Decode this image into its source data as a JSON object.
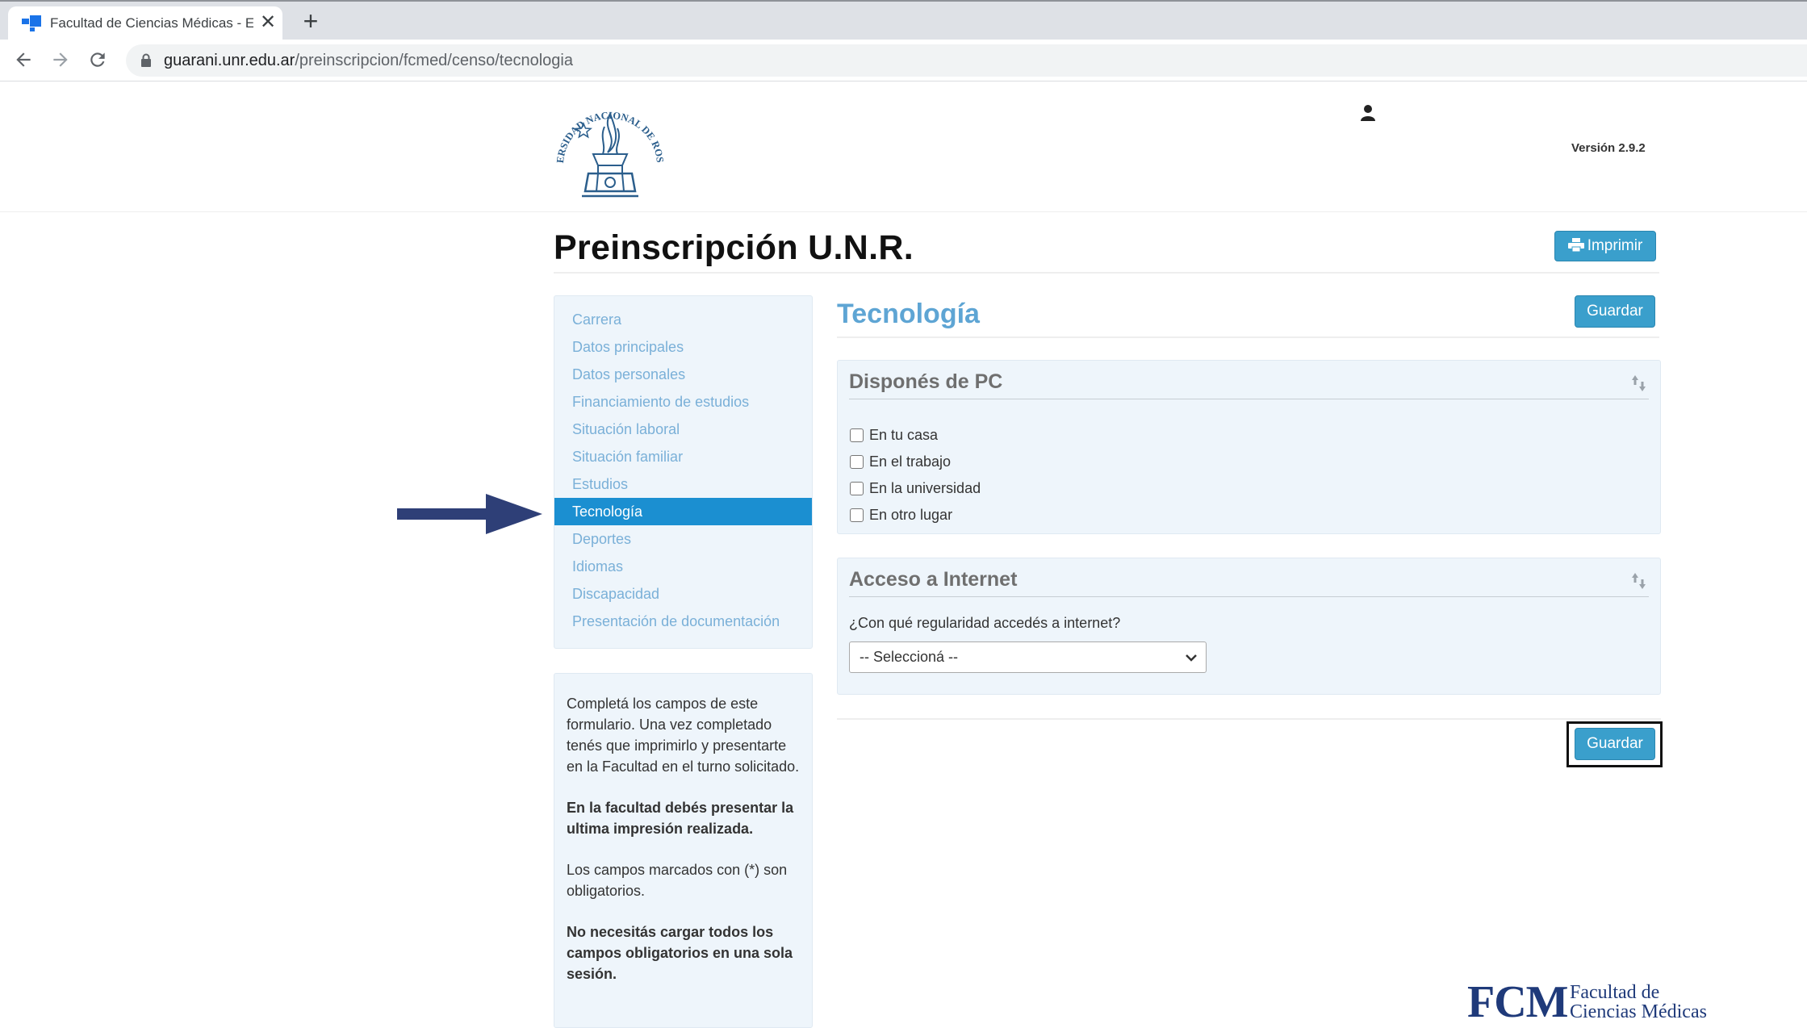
{
  "browser": {
    "tab_title": "Facultad de Ciencias Médicas - E",
    "close_glyph": "✕",
    "newtab_glyph": "+",
    "url_host": "guarani.unr.edu.ar",
    "url_path": "/preinscripcion/fcmed/censo/tecnologia"
  },
  "header": {
    "logo_name": "university-seal-logo",
    "logo_text": "UNIVERSIDAD NACIONAL DE ROSARIO",
    "version": "Versión 2.9.2"
  },
  "title": {
    "text": "Preinscripción U.N.R.",
    "print_label": "Imprimir"
  },
  "sidebar": {
    "items": [
      {
        "label": "Carrera",
        "active": false
      },
      {
        "label": "Datos principales",
        "active": false
      },
      {
        "label": "Datos personales",
        "active": false
      },
      {
        "label": "Financiamiento de estudios",
        "active": false
      },
      {
        "label": "Situación laboral",
        "active": false
      },
      {
        "label": "Situación familiar",
        "active": false
      },
      {
        "label": "Estudios",
        "active": false
      },
      {
        "label": "Tecnología",
        "active": true
      },
      {
        "label": "Deportes",
        "active": false
      },
      {
        "label": "Idiomas",
        "active": false
      },
      {
        "label": "Discapacidad",
        "active": false
      },
      {
        "label": "Presentación de documentación",
        "active": false
      }
    ]
  },
  "help": {
    "p1": "Completá los campos de este formulario. Una vez completado tenés que imprimirlo y presentarte en la Facultad en el turno solicitado.",
    "p2": "En la facultad debés presentar la ultima impresión realizada.",
    "p3": "Los campos marcados con (*) son obligatorios.",
    "p4": "No necesitás cargar todos los campos obligatorios en una sola sesión."
  },
  "main": {
    "section_title": "Tecnología",
    "save_label": "Guardar",
    "pc_panel": {
      "title": "Disponés de PC",
      "options": [
        {
          "label": "En tu casa",
          "checked": false
        },
        {
          "label": "En el trabajo",
          "checked": false
        },
        {
          "label": "En la universidad",
          "checked": false
        },
        {
          "label": "En otro lugar",
          "checked": false
        }
      ]
    },
    "internet_panel": {
      "title": "Acceso a Internet",
      "question": "¿Con qué regularidad accedés a internet?",
      "select_value": "-- Seleccioná --"
    }
  },
  "branding": {
    "letters": "FCM",
    "line1": "Facultad de",
    "line2": "Ciencias Médicas"
  },
  "colors": {
    "accent": "#3a9fcc",
    "active_nav": "#1b8fd1",
    "section_title": "#5ea5d4",
    "panel_bg": "#eef5fb",
    "annotation_arrow": "#2e3f77"
  }
}
